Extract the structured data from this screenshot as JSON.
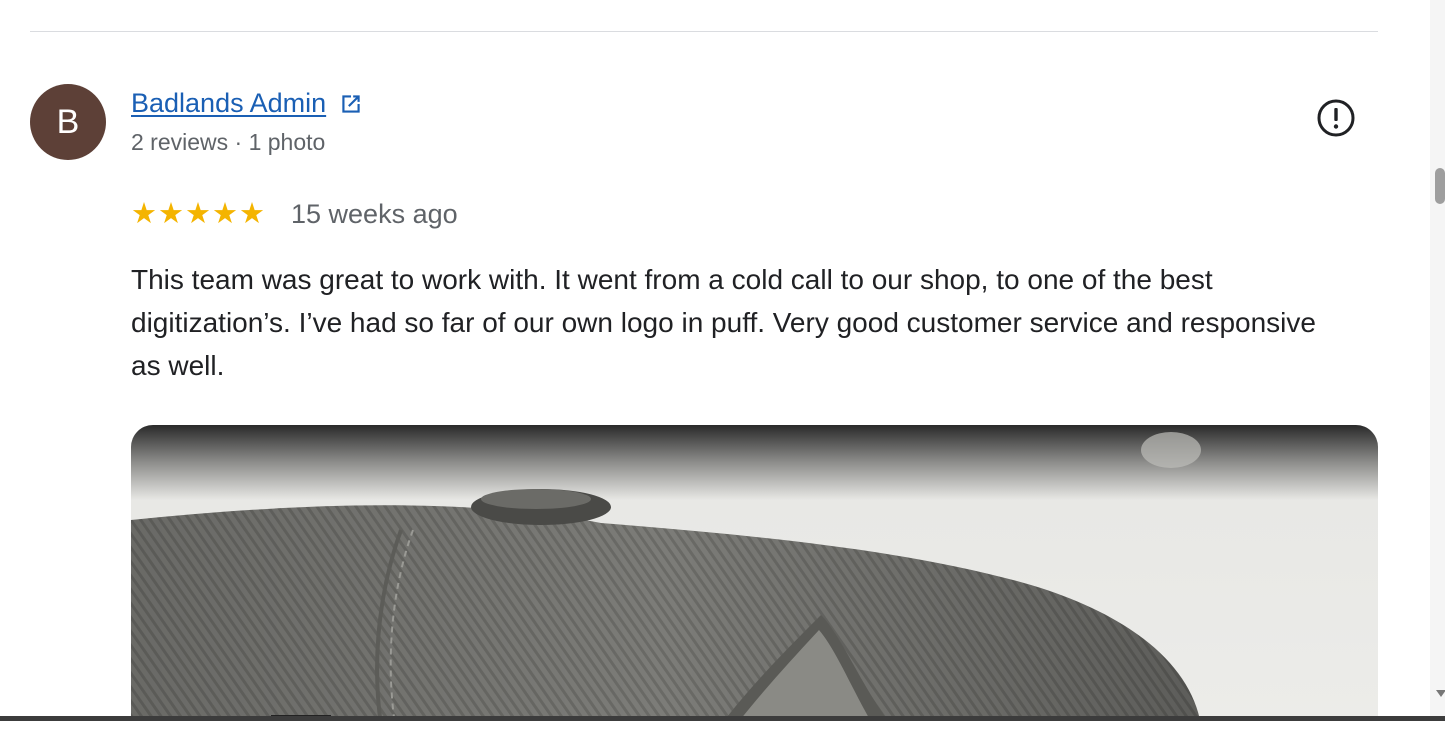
{
  "review": {
    "avatar_letter": "B",
    "author_name": "Badlands Admin",
    "author_meta": "2 reviews · 1 photo",
    "rating": 5,
    "stars": [
      "★",
      "★",
      "★",
      "★",
      "★"
    ],
    "date": "15 weeks ago",
    "text": "This team was great to work with. It went from a cold call to our shop, to one of the best digitization’s. I’ve had so far of our own logo in puff. Very good customer service and responsive as well.",
    "icons": {
      "external_link": "external-link-icon",
      "report": "report-icon"
    }
  },
  "colors": {
    "link": "#1a5fb4",
    "star": "#f4b400",
    "avatar_bg": "#5d4037",
    "secondary_text": "#5f6368"
  }
}
